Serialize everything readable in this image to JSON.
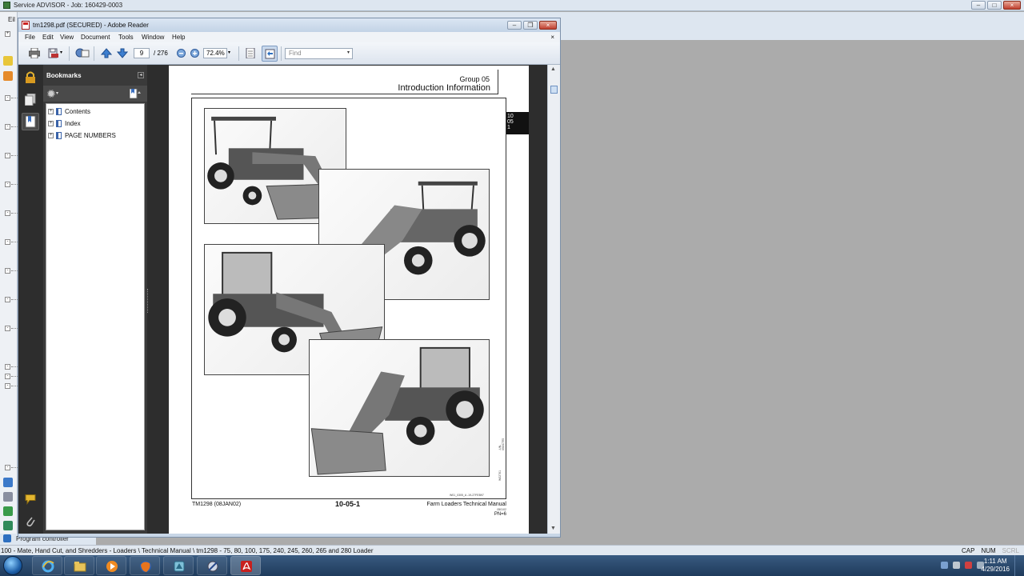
{
  "outer_window": {
    "title": "Service ADVISOR - Job: 160429-0003",
    "menu_stub": "Eil",
    "bottom_panel_label": "Program controller"
  },
  "reader": {
    "title": "tm1298.pdf (SECURED) - Adobe Reader",
    "menu": [
      "File",
      "Edit",
      "View",
      "Document",
      "Tools",
      "Window",
      "Help"
    ],
    "doc_close": "×",
    "toolbar": {
      "page_current": "9",
      "page_total": "/ 276",
      "zoom": "72.4%",
      "find_placeholder": "Find"
    },
    "bookmarks": {
      "title": "Bookmarks",
      "items": [
        "Contents",
        "Index",
        "PAGE NUMBERS"
      ]
    }
  },
  "page": {
    "group": "Group  05",
    "title": "Introduction Information",
    "tab_marker": [
      "10",
      "05",
      "1"
    ],
    "figure_code": "W01_0305_A  -19-27FEB97",
    "side_code": "-UN-05OCT95",
    "side_ref": "W02761",
    "footer_left": "TM1298 (08JAN02)",
    "footer_center": "10-05-1",
    "footer_right": "Farm Loaders Technical Manual",
    "footer_date": "050102",
    "footer_pn": "PN=6"
  },
  "status_bar": {
    "path": "100 - Mate, Hand Cut, and Shredders - Loaders \\ Technical Manual \\ tm1298 - 75, 80, 100, 175, 240, 245, 260, 265 and 280 Loader",
    "keys": [
      "CAP",
      "NUM",
      "SCRL"
    ]
  },
  "taskbar": {
    "time": "1:11 AM",
    "date": "4/29/2016"
  },
  "icons": [
    "windows-start",
    "internet-explorer",
    "file-explorer",
    "media-player",
    "firefox",
    "service-advisor",
    "network-tool",
    "adobe-reader"
  ]
}
